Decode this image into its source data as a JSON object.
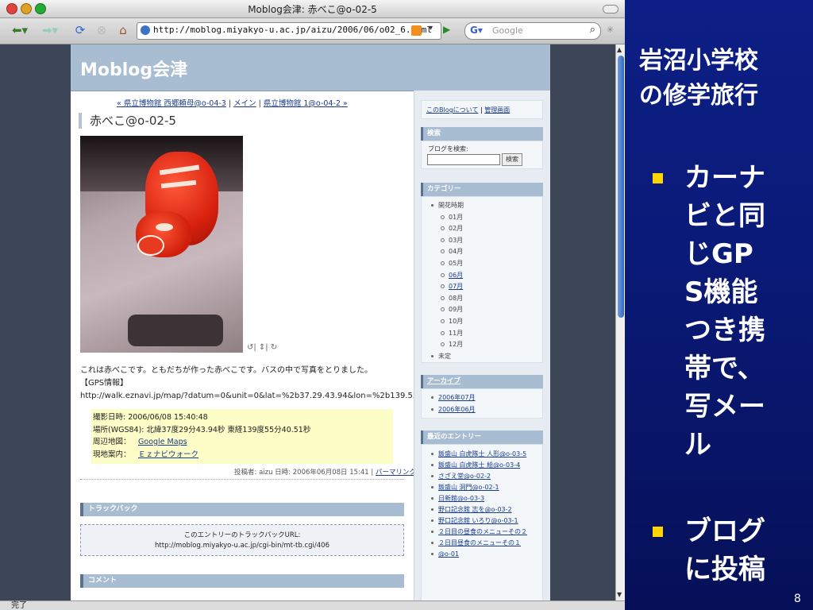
{
  "browser": {
    "window_title": "Moblog会津: 赤べこ@o-02-5",
    "url": "http://moblog.miyakyo-u.ac.jp/aizu/2006/06/o02_6.html",
    "search_placeholder": "Google",
    "search_engine_label": "G",
    "status": "完了"
  },
  "blog": {
    "title": "Moblog会津",
    "nav": {
      "prev": "« 県立博物館 西郷頼母@o-04-3",
      "sep1": " | ",
      "main": "メイン",
      "sep2": " | ",
      "next": "県立博物館 1@o-04-2 »"
    },
    "entry_title": "赤べこ@o-02-5",
    "rotate_icons": "↺| ⇕| ↻",
    "entry_lines": [
      "これは赤べこです。ともだちが作った赤べこです。バスの中で写真をとりました。",
      "【GPS情報】",
      "http://walk.eznavi.jp/map/?datum=0&unit=0&lat=%2b37.29.43.94&lon=%2b139.55.40.51&"
    ],
    "info": {
      "shot_time_label": "撮影日時:",
      "shot_time": "2006/06/08 15:40:48",
      "location_label": "場所(WGS84):",
      "location": "北緯37度29分43.94秒 東経139度55分40.51秒",
      "map_label": "周辺地図：",
      "map_link": "Google Maps",
      "guide_label": "現地案内：",
      "guide_link": "Ｅｚナビウォーク"
    },
    "footer": "投稿者: aizu 日時: 2006年06月08日 15:41 | ",
    "permalink": "パーマリンク",
    "trackback_header": "トラックバック",
    "trackback_label": "このエントリーのトラックバックURL:",
    "trackback_url": "http://moblog.miyakyo-u.ac.jp/cgi-bin/mt-tb.cgi/406",
    "comment_header": "コメント"
  },
  "sidebar": {
    "about": "このBlogについて",
    "sep": " | ",
    "admin": "管理画面",
    "search_header": "検索",
    "search_label": "ブログを検索:",
    "search_button": "検索",
    "category_header": "カテゴリー",
    "category_root": "開花時期",
    "months": [
      "01月",
      "02月",
      "03月",
      "04月",
      "05月",
      "06月",
      "07月",
      "08月",
      "09月",
      "10月",
      "11月",
      "12月"
    ],
    "uncategorized": "未定",
    "archive_header": "アーカイブ",
    "archives": [
      "2006年07月",
      "2006年06月"
    ],
    "recent_header": "最近のエントリー",
    "recent": [
      "飯盛山 白虎隊士 人形@o-03-5",
      "飯盛山 白虎隊士 絵@o-03-4",
      "さざえ堂@o-02-2",
      "飯盛山 洞門@o-02-1",
      "日新館@o-03-3",
      "野口記念館 志を@o-03-2",
      "野口記念館 いろり@o-03-1",
      "２日目の昼食のメニューその２",
      "２日目昼食のメニューその１",
      "@o-01"
    ]
  },
  "slide": {
    "title": "岩沼小学校の修学旅行",
    "bullet1": "カーナビと同じGPS機能つき携帯で、写メール",
    "bullet2": "ブログに投稿",
    "page_number": "8",
    "bullet_color": "#ffd400"
  }
}
